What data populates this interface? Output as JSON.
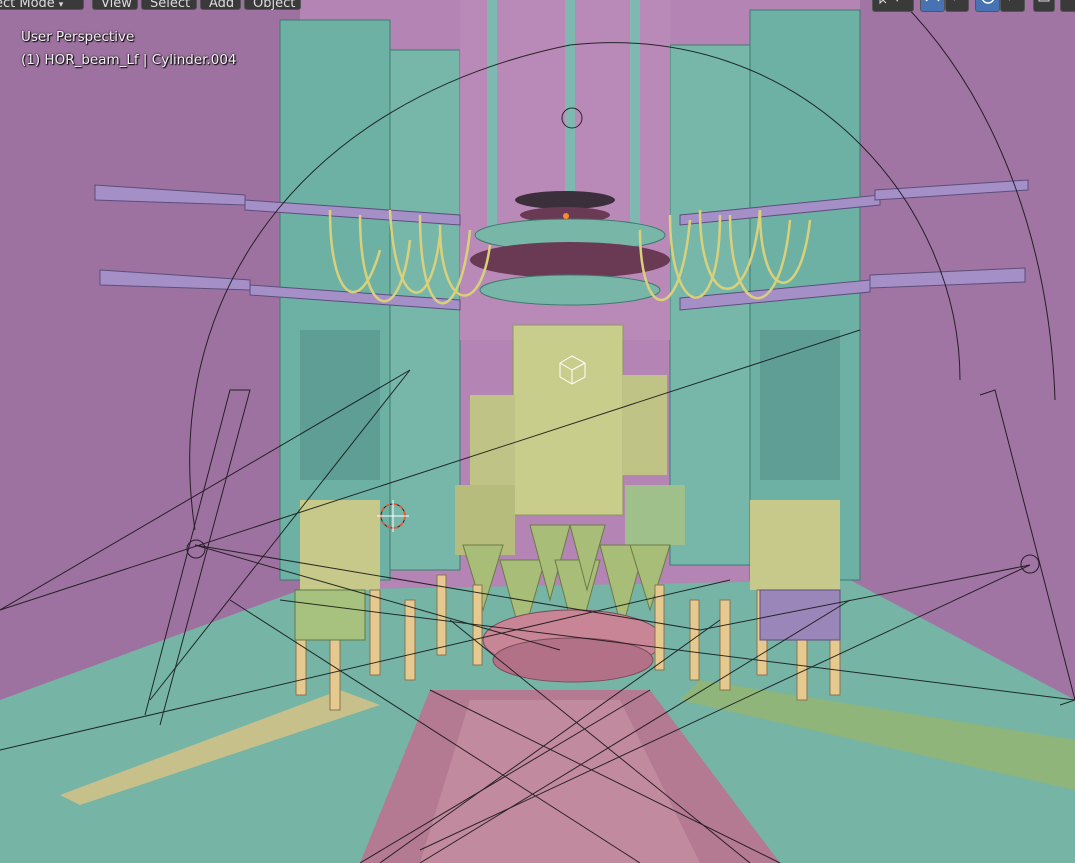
{
  "header": {
    "mode_label": "ect Mode",
    "menus": {
      "view": "View",
      "select": "Select",
      "add": "Add",
      "object": "Object"
    }
  },
  "overlay": {
    "perspective": "User Perspective",
    "active_object": "(1) HOR_beam_Lf | Cylinder.004"
  },
  "colors": {
    "wall": "#a579a2",
    "floor": "#76b4a6",
    "teal_structure": "#6fb1a3",
    "yellow_panel": "#c6c98a",
    "header_button": "#3a3a3a",
    "active_button": "#4772b3"
  },
  "icons": [
    "cursor-icon",
    "curve-icon",
    "overlay-icon",
    "view-icon"
  ]
}
